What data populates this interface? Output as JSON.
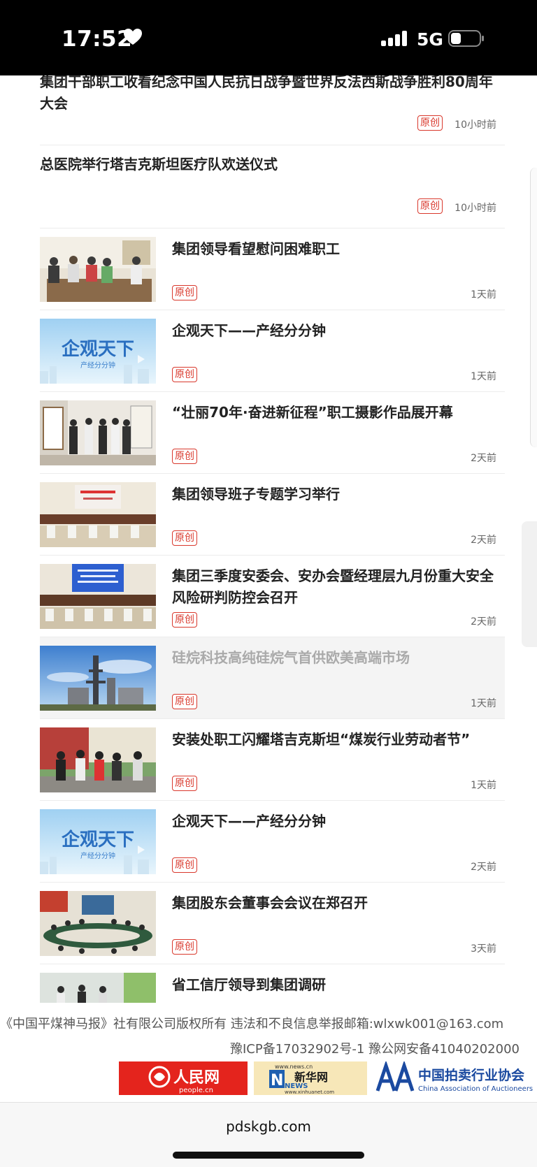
{
  "status_bar": {
    "time": "17:52",
    "network": "5G"
  },
  "articles": [
    {
      "title": "集团干部职工收看纪念中国人民抗日战争暨世界反法西斯战争胜利80周年大会",
      "badge": "原创",
      "time": "10小时前"
    },
    {
      "title": "总医院举行塔吉克斯坦医疗队欢送仪式",
      "badge": "原创",
      "time": "10小时前"
    },
    {
      "title": "集团领导看望慰问困难职工",
      "badge": "原创",
      "time": "1天前",
      "thumb": "photo-visit"
    },
    {
      "title": "企观天下——产经分分钟",
      "badge": "原创",
      "time": "1天前",
      "thumb": "video-sky",
      "thumb_title": "企观天下",
      "thumb_sub": "产经分分钟"
    },
    {
      "title": "“壮丽70年·奋进新征程”职工摄影作品展开幕",
      "badge": "原创",
      "time": "2天前",
      "thumb": "photo-exhibition"
    },
    {
      "title": "集团领导班子专题学习举行",
      "badge": "原创",
      "time": "2天前",
      "thumb": "photo-meeting"
    },
    {
      "title": "集团三季度安委会、安办会暨经理层九月份重大安全风险研判防控会召开",
      "badge": "原创",
      "time": "2天前",
      "thumb": "photo-conference"
    },
    {
      "title": "硅烷科技高纯硅烷气首供欧美高端市场",
      "badge": "原创",
      "time": "1天前",
      "thumb": "photo-plant"
    },
    {
      "title": "安装处职工闪耀塔吉克斯坦“煤炭行业劳动者节”",
      "badge": "原创",
      "time": "1天前",
      "thumb": "photo-festival"
    },
    {
      "title": "企观天下——产经分分钟",
      "badge": "原创",
      "time": "2天前",
      "thumb": "video-sky",
      "thumb_title": "企观天下",
      "thumb_sub": "产经分分钟"
    },
    {
      "title": "集团股东会董事会会议在郑召开",
      "badge": "原创",
      "time": "3天前",
      "thumb": "photo-boardroom"
    },
    {
      "title": "省工信厅领导到集团调研",
      "badge": "",
      "time": "",
      "thumb": "photo-research"
    }
  ],
  "footer": {
    "copyright": "《中国平煤神马报》社有限公司版权所有 违法和不良信息举报邮箱:wlxwk001@163.com",
    "icp": "豫ICP备17032902号-1  豫公网安备41040202000",
    "logos": {
      "people": {
        "main": "人民网",
        "sub": "people.cn"
      },
      "xinhua": {
        "main": "新华网",
        "sub": "www.news.cn",
        "word": "NEWS",
        "url2": "www.xinhuanet.com"
      },
      "caa": {
        "cn": "中国拍卖行业协会",
        "en": "China Association of Auctioneers"
      }
    }
  },
  "browser": {
    "url": "pdskgb.com"
  },
  "colors": {
    "badge": "#d9382c",
    "people_red": "#e4241d",
    "caa_blue": "#1b4aa0"
  }
}
